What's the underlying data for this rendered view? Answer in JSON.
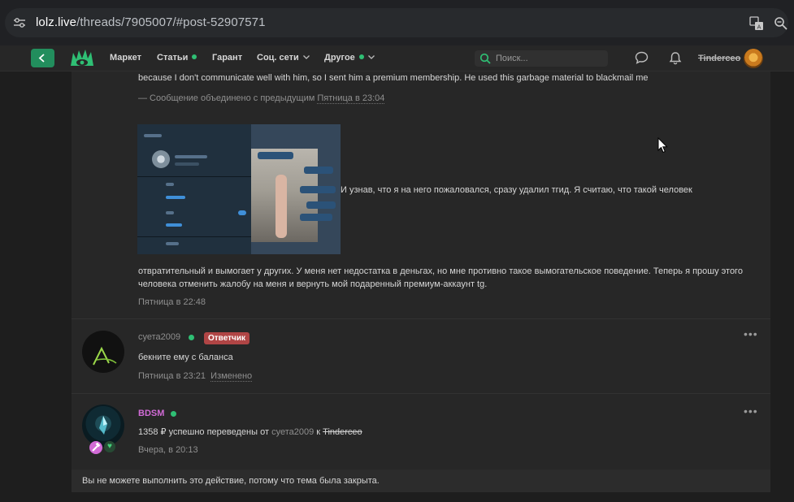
{
  "browser": {
    "url_host": "lolz.live",
    "url_path": "/threads/7905007/#post-52907571"
  },
  "nav": {
    "items": [
      {
        "label": "Маркет"
      },
      {
        "label": "Статьи"
      },
      {
        "label": "Гарант"
      },
      {
        "label": "Соц. сети"
      },
      {
        "label": "Другое"
      }
    ],
    "search_placeholder": "Поиск...",
    "username": "Tinderceo"
  },
  "post1": {
    "line1": "because I don't communicate well with him, so I sent him a premium membership. He used this garbage material to blackmail me",
    "merged_prefix": "— Сообщение объединено с предыдущим",
    "merged_time": "Пятница в 23:04",
    "text_after_image": "И узнав, что я на него пожаловался, сразу удалил тгид. Я считаю, что такой человек",
    "text_line2": "отвратительный и вымогает у других. У меня нет недостатка в деньгах, но мне противно такое вымогательское поведение. Теперь я прошу этого",
    "text_line3": "человека отменить жалобу на меня и вернуть мой подаренный премиум-аккаунт tg.",
    "time": "Пятница в 22:48"
  },
  "post2": {
    "author": "суета2009",
    "badge": "Ответчик",
    "text": "бекните ему с баланса",
    "time": "Пятница в 23:21",
    "edited": "Изменено"
  },
  "post3": {
    "author": "BDSM",
    "text_prefix": "1358 ₽ успешно переведены от",
    "from_user": "суета2009",
    "to_word": "к",
    "to_user": "Tinderceo",
    "time": "Вчера, в 20:13",
    "award_icon": "heart-icon"
  },
  "closed_notice": "Вы не можете выполнить это действие, потому что тема была закрыта.",
  "colors": {
    "accent_green": "#228e5d",
    "online_green": "#2fbf74",
    "badge_red": "#b04545",
    "bdsm_pink": "#d16bd6"
  }
}
